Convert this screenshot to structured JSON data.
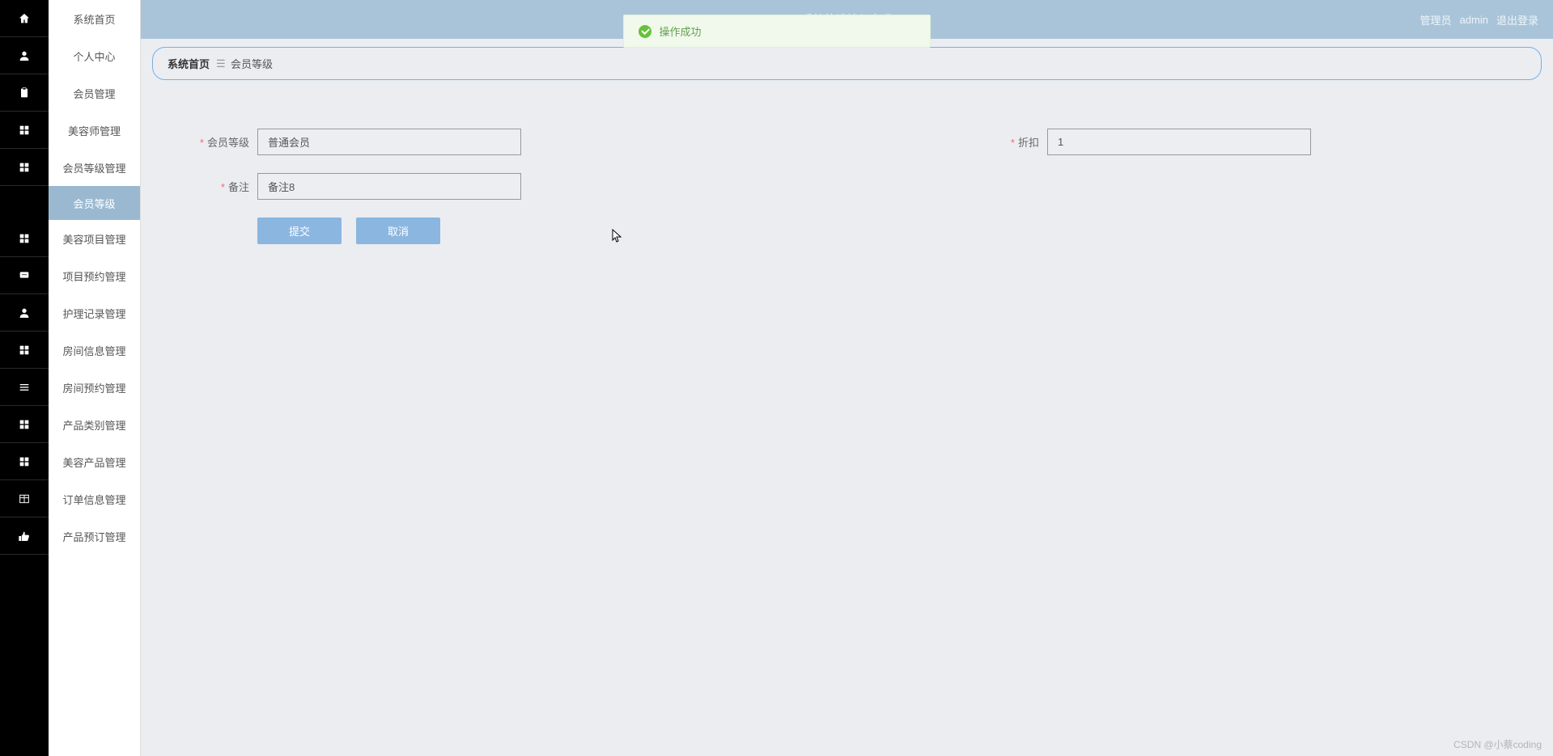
{
  "sidebar": {
    "items": [
      {
        "label": "系统首页",
        "icon": "home"
      },
      {
        "label": "个人中心",
        "icon": "user"
      },
      {
        "label": "会员管理",
        "icon": "clipboard"
      },
      {
        "label": "美容师管理",
        "icon": "grid"
      },
      {
        "label": "会员等级管理",
        "icon": "grid",
        "sub": "会员等级"
      },
      {
        "label": "美容项目管理",
        "icon": "grid"
      },
      {
        "label": "项目预约管理",
        "icon": "chat"
      },
      {
        "label": "护理记录管理",
        "icon": "user"
      },
      {
        "label": "房间信息管理",
        "icon": "grid"
      },
      {
        "label": "房间预约管理",
        "icon": "list"
      },
      {
        "label": "产品类别管理",
        "icon": "grid"
      },
      {
        "label": "美容产品管理",
        "icon": "grid"
      },
      {
        "label": "订单信息管理",
        "icon": "table"
      },
      {
        "label": "产品预订管理",
        "icon": "thumb"
      }
    ]
  },
  "header": {
    "center_title": "系统的设计与实现",
    "admin_role": "管理员",
    "admin_name": "admin",
    "logout": "退出登录"
  },
  "toast": {
    "text": "操作成功"
  },
  "breadcrumb": {
    "home": "系统首页",
    "current": "会员等级"
  },
  "form": {
    "member_level": {
      "label": "会员等级",
      "value": "普通会员"
    },
    "discount": {
      "label": "折扣",
      "value": "1"
    },
    "remark": {
      "label": "备注",
      "value": "备注8"
    },
    "submit": "提交",
    "cancel": "取消"
  },
  "watermark": "CSDN @小蔡coding"
}
